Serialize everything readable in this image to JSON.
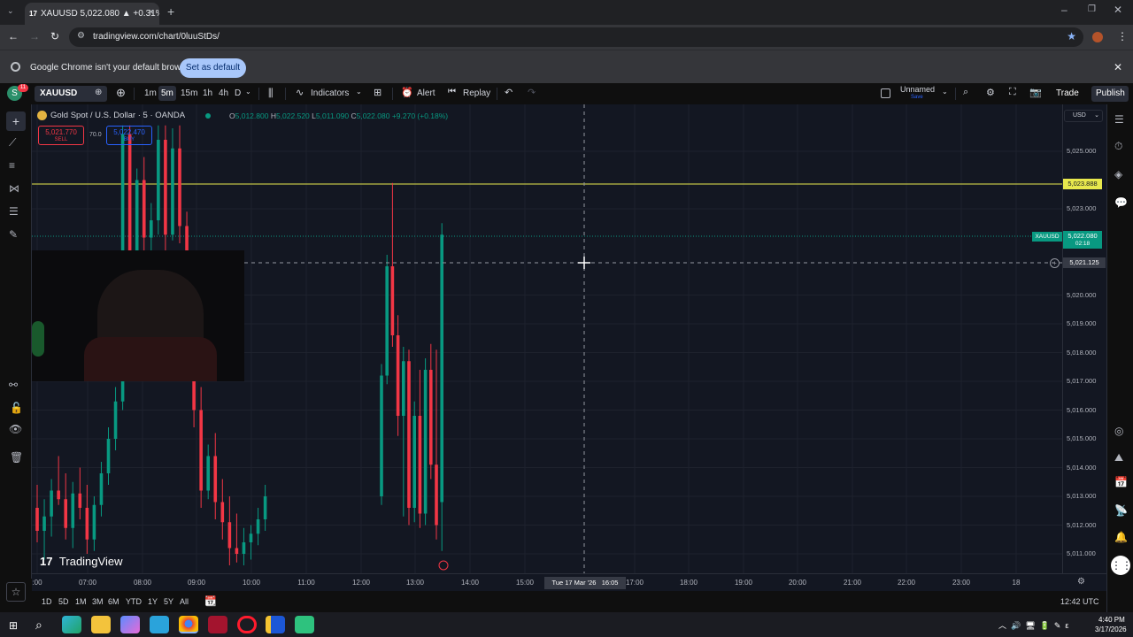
{
  "browser": {
    "tab_title": "XAUUSD 5,022.080 ▲ +0.31% U",
    "tab_icon": "17",
    "url": "tradingview.com/chart/0luuStDs/",
    "infobar_message": "Google Chrome isn't your default browser",
    "infobar_button": "Set as default"
  },
  "toolbar": {
    "avatar_letter": "S",
    "notif_count": "11",
    "symbol": "XAUUSD",
    "intervals": [
      "1m",
      "5m",
      "15m",
      "1h",
      "4h",
      "D"
    ],
    "active_interval": "5m",
    "indicators_label": "Indicators",
    "alert_label": "Alert",
    "replay_label": "Replay",
    "layout_name": "Unnamed",
    "layout_sub": "Save",
    "trade_label": "Trade",
    "publish_label": "Publish"
  },
  "legend": {
    "title": "Gold Spot / U.S. Dollar · 5 · OANDA",
    "o_label": "O",
    "o": "5,012.800",
    "h_label": "H",
    "h": "5,022.520",
    "l_label": "L",
    "l": "5,011.090",
    "c_label": "C",
    "c": "5,022.080",
    "change": "+9.270 (+0.18%)",
    "sell_price": "5,021.770",
    "sell_label": "SELL",
    "spread": "70.0",
    "buy_price": "5,022.470",
    "buy_label": "BUY"
  },
  "watermark": "TradingView",
  "price_axis": {
    "currency": "USD",
    "ticks": [
      "5,025.000",
      "5,023.000",
      "5,020.000",
      "5,019.000",
      "5,018.000",
      "5,017.000",
      "5,016.000",
      "5,015.000",
      "5,014.000",
      "5,013.000",
      "5,012.000",
      "5,011.000"
    ],
    "hline_price": "5,023.888",
    "symbol_tag": "XAUUSD",
    "last_price": "5,022.080",
    "countdown": "02:18",
    "crosshair_price": "5,021.125"
  },
  "time_axis": {
    "ticks": [
      ":00",
      "07:00",
      "08:00",
      "09:00",
      "10:00",
      "11:00",
      "12:00",
      "13:00",
      "14:00",
      "15:00",
      "17:00",
      "18:00",
      "19:00",
      "20:00",
      "21:00",
      "22:00",
      "23:00",
      "18"
    ],
    "crosshair_label": "Tue 17 Mar '26   16:05"
  },
  "bottom": {
    "ranges": [
      "1D",
      "5D",
      "1M",
      "3M",
      "6M",
      "YTD",
      "1Y",
      "5Y",
      "All"
    ],
    "clock": "12:42 UTC"
  },
  "taskbar": {
    "time": "4:40 PM",
    "date": "3/17/2026"
  },
  "colors": {
    "bull": "#089981",
    "bear": "#f23645",
    "hline": "#e8e84d",
    "accent": "#2962ff"
  },
  "chart_data": {
    "type": "candlestick",
    "title": "Gold Spot / U.S. Dollar · 5 · OANDA",
    "ylim": [
      5010.5,
      5025.9
    ],
    "candles": [
      {
        "t": 0,
        "o": 5012.6,
        "h": 5013.4,
        "l": 5011.4,
        "c": 5011.8
      },
      {
        "t": 1,
        "o": 5011.8,
        "h": 5012.9,
        "l": 5010.8,
        "c": 5012.3
      },
      {
        "t": 2,
        "o": 5012.3,
        "h": 5013.6,
        "l": 5011.6,
        "c": 5013.2
      },
      {
        "t": 3,
        "o": 5013.2,
        "h": 5014.4,
        "l": 5012.7,
        "c": 5012.9
      },
      {
        "t": 4,
        "o": 5012.9,
        "h": 5013.8,
        "l": 5011.5,
        "c": 5011.9
      },
      {
        "t": 5,
        "o": 5011.9,
        "h": 5013.5,
        "l": 5011.2,
        "c": 5013.1
      },
      {
        "t": 6,
        "o": 5013.1,
        "h": 5014.0,
        "l": 5012.2,
        "c": 5012.6
      },
      {
        "t": 7,
        "o": 5012.6,
        "h": 5013.4,
        "l": 5011.0,
        "c": 5011.5
      },
      {
        "t": 8,
        "o": 5011.5,
        "h": 5013.0,
        "l": 5011.1,
        "c": 5012.7
      },
      {
        "t": 9,
        "o": 5012.7,
        "h": 5014.2,
        "l": 5012.3,
        "c": 5013.8
      },
      {
        "t": 10,
        "o": 5013.8,
        "h": 5015.4,
        "l": 5013.4,
        "c": 5015.0
      },
      {
        "t": 11,
        "o": 5015.0,
        "h": 5016.8,
        "l": 5014.6,
        "c": 5016.3
      },
      {
        "t": 12,
        "o": 5016.3,
        "h": 5025.9,
        "l": 5016.0,
        "c": 5025.6
      },
      {
        "t": 13,
        "o": 5025.6,
        "h": 5025.9,
        "l": 5019.2,
        "c": 5020.0
      },
      {
        "t": 14,
        "o": 5020.0,
        "h": 5024.4,
        "l": 5019.6,
        "c": 5024.0
      },
      {
        "t": 15,
        "o": 5024.0,
        "h": 5024.8,
        "l": 5021.2,
        "c": 5022.0
      },
      {
        "t": 16,
        "o": 5022.0,
        "h": 5023.2,
        "l": 5020.8,
        "c": 5022.6
      },
      {
        "t": 17,
        "o": 5022.6,
        "h": 5025.9,
        "l": 5022.1,
        "c": 5025.4
      },
      {
        "t": 18,
        "o": 5025.4,
        "h": 5025.9,
        "l": 5021.5,
        "c": 5022.1
      },
      {
        "t": 19,
        "o": 5022.1,
        "h": 5025.8,
        "l": 5021.9,
        "c": 5025.1
      },
      {
        "t": 20,
        "o": 5025.1,
        "h": 5025.9,
        "l": 5021.8,
        "c": 5022.4
      },
      {
        "t": 21,
        "o": 5022.4,
        "h": 5022.9,
        "l": 5019.1,
        "c": 5019.6
      },
      {
        "t": 22,
        "o": 5019.6,
        "h": 5020.4,
        "l": 5015.4,
        "c": 5016.0
      },
      {
        "t": 23,
        "o": 5016.0,
        "h": 5016.8,
        "l": 5012.6,
        "c": 5013.2
      },
      {
        "t": 24,
        "o": 5013.2,
        "h": 5014.8,
        "l": 5012.9,
        "c": 5014.4
      },
      {
        "t": 25,
        "o": 5014.4,
        "h": 5015.2,
        "l": 5012.2,
        "c": 5012.8
      },
      {
        "t": 26,
        "o": 5012.8,
        "h": 5013.6,
        "l": 5011.5,
        "c": 5012.1
      },
      {
        "t": 27,
        "o": 5012.1,
        "h": 5013.0,
        "l": 5010.6,
        "c": 5011.2
      },
      {
        "t": 28,
        "o": 5011.2,
        "h": 5012.4,
        "l": 5010.7,
        "c": 5011.0
      },
      {
        "t": 29,
        "o": 5011.0,
        "h": 5011.9,
        "l": 5010.6,
        "c": 5011.4
      },
      {
        "t": 30,
        "o": 5011.4,
        "h": 5012.0,
        "l": 5010.8,
        "c": 5011.7
      },
      {
        "t": 31,
        "o": 5011.7,
        "h": 5012.6,
        "l": 5011.3,
        "c": 5012.2
      },
      {
        "t": 32,
        "o": 5012.2,
        "h": 5013.4,
        "l": 5011.8,
        "c": 5013.0
      },
      {
        "t": 33,
        "o": 5013.0,
        "h": 5017.6,
        "l": 5012.7,
        "c": 5017.2
      },
      {
        "t": 34,
        "o": 5017.2,
        "h": 5021.4,
        "l": 5016.9,
        "c": 5021.0
      },
      {
        "t": 35,
        "o": 5021.0,
        "h": 5023.9,
        "l": 5018.2,
        "c": 5018.6
      },
      {
        "t": 36,
        "o": 5018.6,
        "h": 5019.3,
        "l": 5015.1,
        "c": 5015.8
      },
      {
        "t": 37,
        "o": 5015.8,
        "h": 5018.2,
        "l": 5012.3,
        "c": 5017.7
      },
      {
        "t": 38,
        "o": 5017.7,
        "h": 5018.1,
        "l": 5012.0,
        "c": 5012.6
      },
      {
        "t": 39,
        "o": 5012.6,
        "h": 5016.3,
        "l": 5012.1,
        "c": 5015.8
      },
      {
        "t": 40,
        "o": 5015.8,
        "h": 5017.4,
        "l": 5011.9,
        "c": 5012.4
      },
      {
        "t": 41,
        "o": 5012.4,
        "h": 5017.8,
        "l": 5012.0,
        "c": 5017.4
      },
      {
        "t": 42,
        "o": 5017.4,
        "h": 5018.3,
        "l": 5013.6,
        "c": 5014.1
      },
      {
        "t": 43,
        "o": 5014.1,
        "h": 5018.1,
        "l": 5011.5,
        "c": 5012.0
      },
      {
        "t": 44,
        "o": 5012.8,
        "h": 5022.5,
        "l": 5011.1,
        "c": 5022.1
      }
    ]
  }
}
